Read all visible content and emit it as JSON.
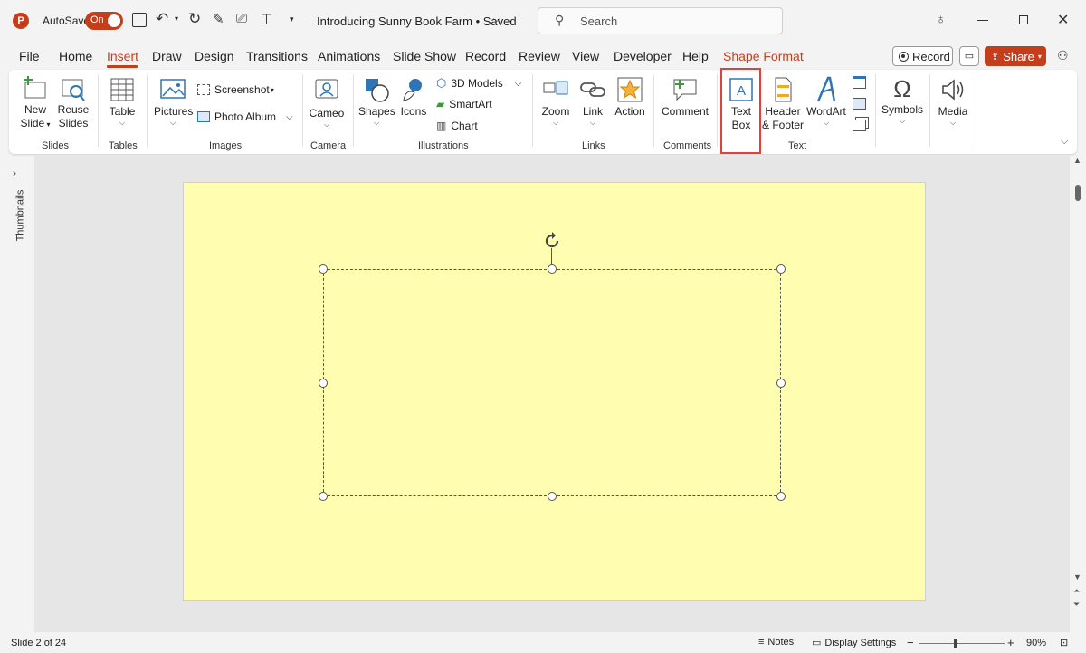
{
  "titlebar": {
    "autosave_label": "AutoSave",
    "autosave_state": "On",
    "doc_title": "Introducing Sunny Book Farm • Saved",
    "search_placeholder": "Search"
  },
  "menu": {
    "tabs": [
      "File",
      "Home",
      "Insert",
      "Draw",
      "Design",
      "Transitions",
      "Animations",
      "Slide Show",
      "Record",
      "Review",
      "View",
      "Developer",
      "Help",
      "Shape Format"
    ],
    "active_tab": "Insert",
    "record_button": "Record",
    "share_button": "Share"
  },
  "ribbon": {
    "new_slide": [
      "New",
      "Slide"
    ],
    "reuse_slides": [
      "Reuse",
      "Slides"
    ],
    "table": "Table",
    "pictures": "Pictures",
    "screenshot": "Screenshot",
    "photo_album": "Photo Album",
    "cameo": "Cameo",
    "shapes": "Shapes",
    "icons": "Icons",
    "models_3d": "3D Models",
    "smartart": "SmartArt",
    "chart": "Chart",
    "zoom": "Zoom",
    "link": "Link",
    "action": "Action",
    "comment": "Comment",
    "text_box": [
      "Text",
      "Box"
    ],
    "header_footer": [
      "Header",
      "& Footer"
    ],
    "wordart": "WordArt",
    "symbols": "Symbols",
    "media": "Media",
    "groups": {
      "slides": "Slides",
      "tables": "Tables",
      "images": "Images",
      "camera": "Camera",
      "illustrations": "Illustrations",
      "links": "Links",
      "comments": "Comments",
      "text": "Text"
    }
  },
  "sidebar": {
    "thumbnails_label": "Thumbnails"
  },
  "slide": {
    "background_color": "#fffdb0"
  },
  "status": {
    "slide_counter": "Slide 2 of 24",
    "notes": "Notes",
    "display_settings": "Display Settings",
    "zoom_level": "90%"
  },
  "colors": {
    "accent": "#c43e1c",
    "highlight": "#e2413b",
    "icon_blue": "#2e75b6"
  }
}
